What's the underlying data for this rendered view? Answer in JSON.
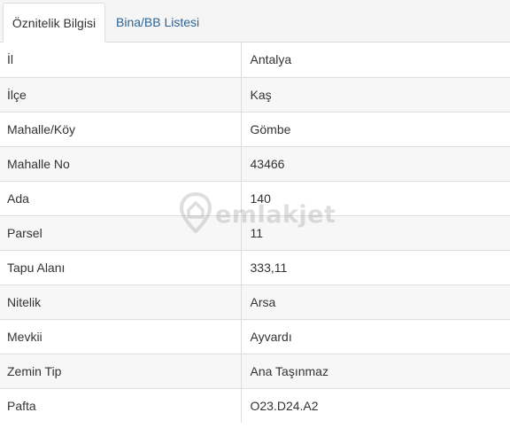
{
  "tabs": [
    {
      "label": "Öznitelik Bilgisi",
      "active": true
    },
    {
      "label": "Bina/BB Listesi",
      "active": false
    }
  ],
  "rows": [
    {
      "key": "İl",
      "value": "Antalya"
    },
    {
      "key": "İlçe",
      "value": "Kaş"
    },
    {
      "key": "Mahalle/Köy",
      "value": "Gömbe"
    },
    {
      "key": "Mahalle No",
      "value": "43466"
    },
    {
      "key": "Ada",
      "value": "140"
    },
    {
      "key": "Parsel",
      "value": "11"
    },
    {
      "key": "Tapu Alanı",
      "value": "333,11"
    },
    {
      "key": "Nitelik",
      "value": "Arsa"
    },
    {
      "key": "Mevkii",
      "value": "Ayvardı"
    },
    {
      "key": "Zemin Tip",
      "value": "Ana Taşınmaz"
    },
    {
      "key": "Pafta",
      "value": "O23.D24.A2"
    }
  ],
  "watermark": {
    "text": "emlakjet",
    "icon": "location-pin-house-icon"
  },
  "colors": {
    "tab_link": "#2a6496",
    "border": "#dddddd",
    "row_alt": "#f7f7f7",
    "text": "#333333"
  }
}
